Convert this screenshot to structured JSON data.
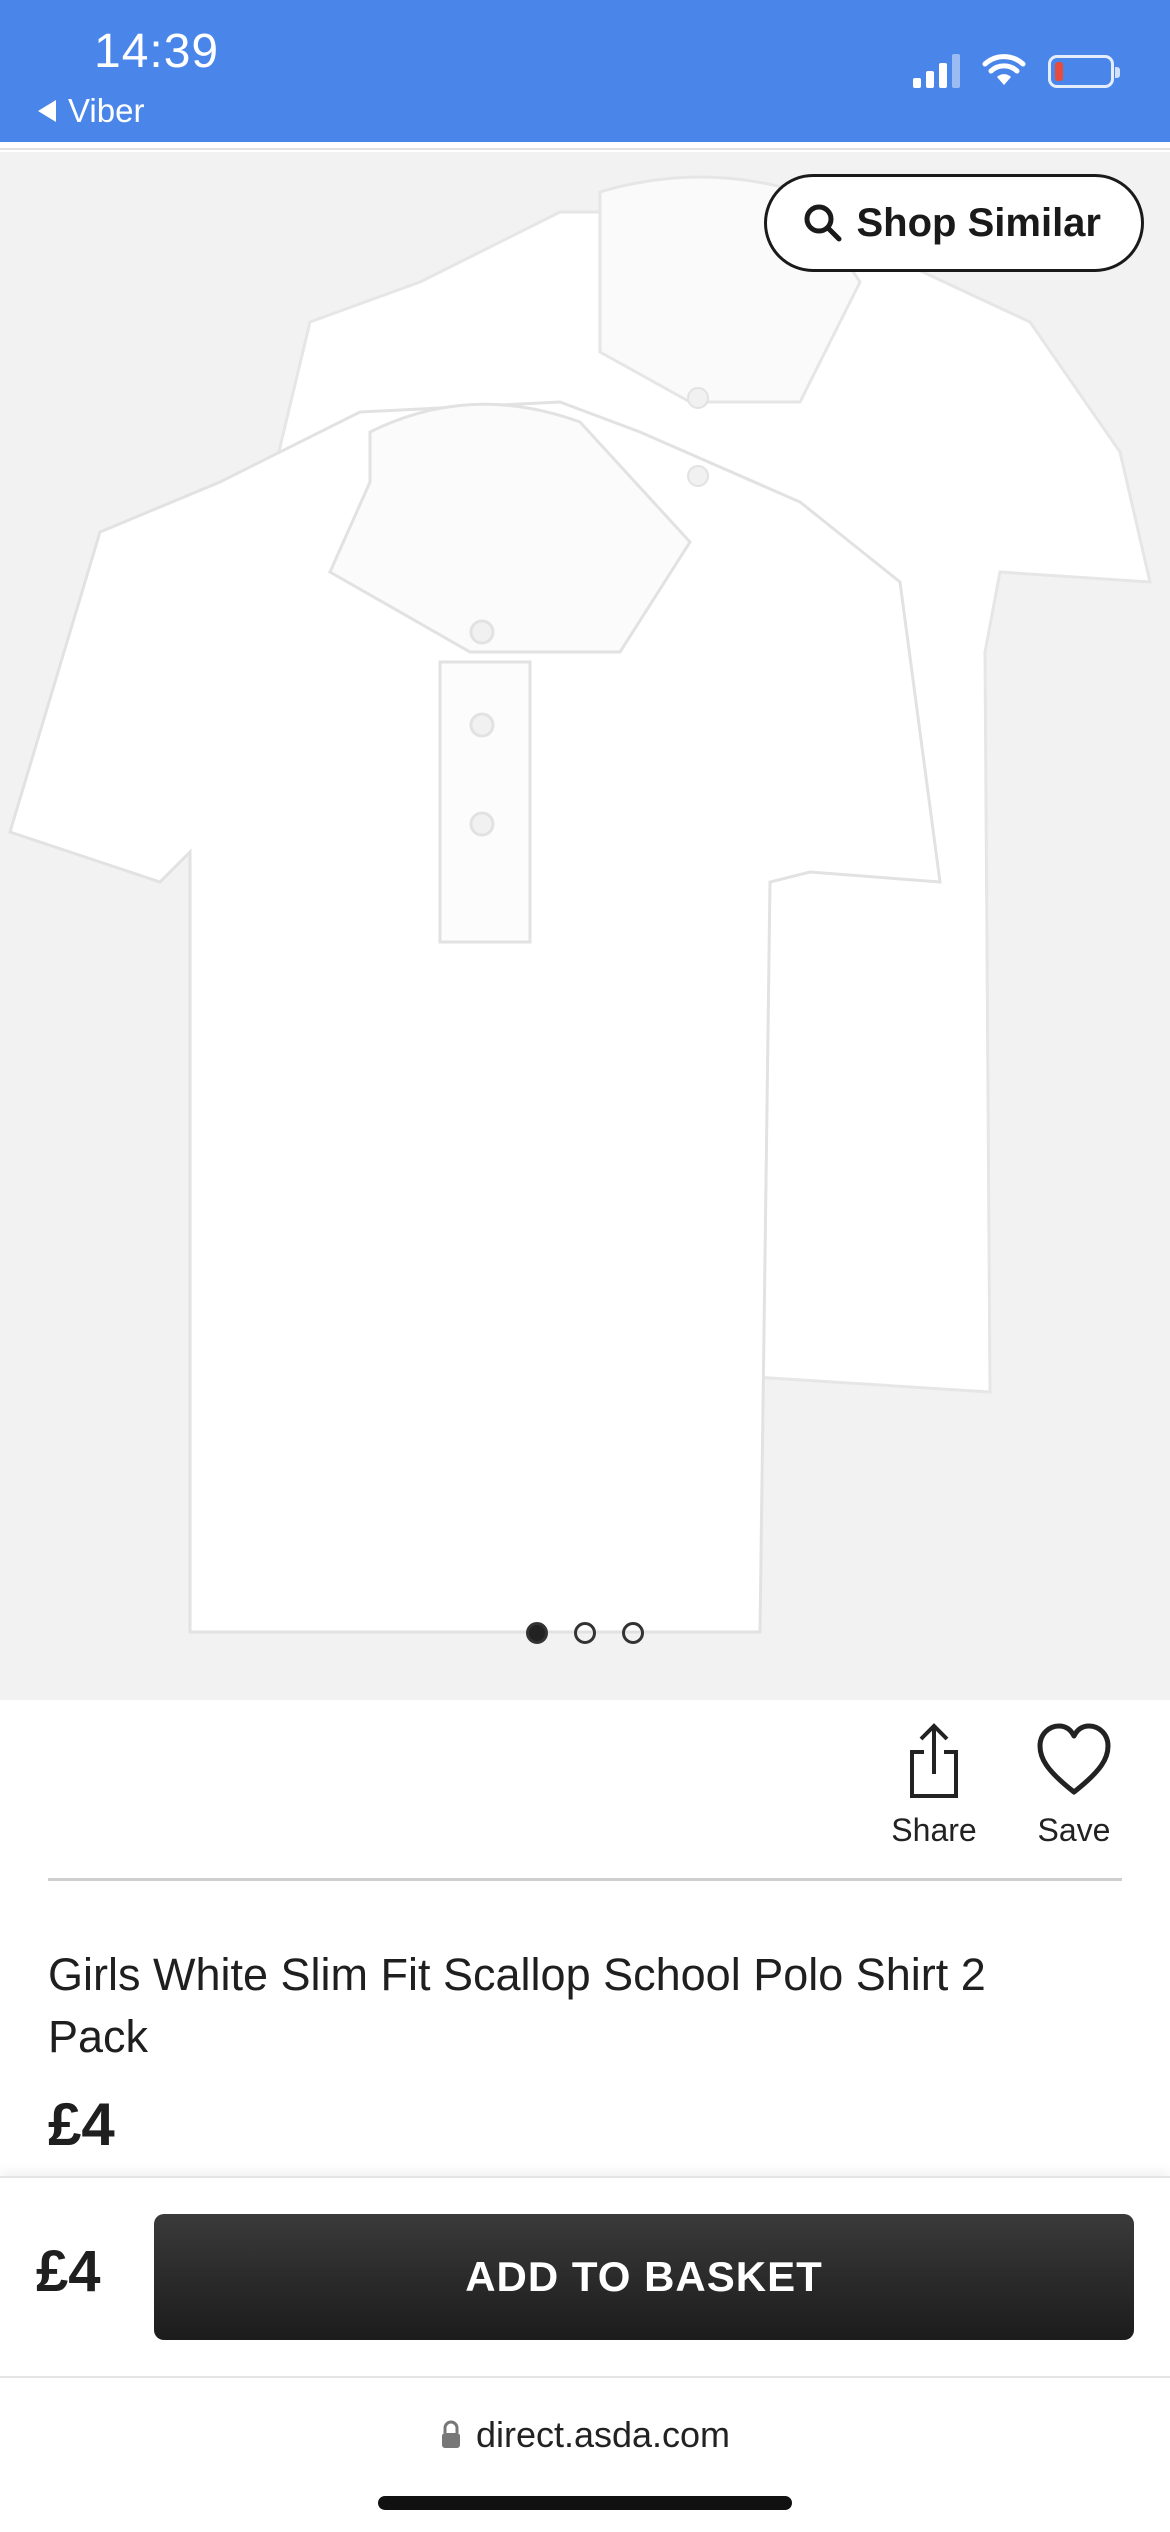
{
  "status_bar": {
    "time": "14:39",
    "back_app": "Viber",
    "battery_level": 0.15,
    "battery_color": "#e84b3c",
    "bar_color": "#4a86ea"
  },
  "gallery": {
    "shop_similar_label": "Shop Similar",
    "shop_similar_icon": "search-icon",
    "dots": [
      {
        "active": true
      },
      {
        "active": false
      },
      {
        "active": false
      }
    ]
  },
  "actions": {
    "share_label": "Share",
    "save_label": "Save"
  },
  "product": {
    "title": "Girls White Slim Fit Scallop School Polo Shirt 2 Pack",
    "price": "£4"
  },
  "sticky_bar": {
    "price": "£4",
    "add_to_basket_label": "ADD TO BASKET"
  },
  "browser": {
    "url": "direct.asda.com"
  }
}
